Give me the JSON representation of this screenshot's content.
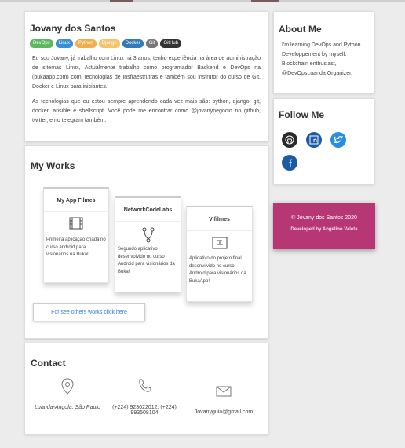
{
  "intro": {
    "name": "Jovany dos Santos",
    "tags": [
      {
        "label": "DevOps",
        "color": "#5cb85c"
      },
      {
        "label": "Linux",
        "color": "#3a8fd6"
      },
      {
        "label": "Python",
        "color": "#f0ad4e"
      },
      {
        "label": "Django",
        "color": "#f5c36b"
      },
      {
        "label": "Docker",
        "color": "#337ab7"
      },
      {
        "label": "Git",
        "color": "#777777"
      },
      {
        "label": "GitHub",
        "color": "#333333"
      }
    ],
    "paragraph1": "Eu sou Jovany, já trabalho com Linux há 3 anos, tenho experiência na área de administração de sitemas Linux, Actualmente trabalho como programador Backend e DevOps na (bukaapp.com) com Tecnologias de Insfraestrutras e também sou instrutor do curso de Git, Docker e Linux para iniciantes.",
    "paragraph2": "As tecnologias que eu estou sempre aprendendo cada vez mais são: python, django, git, docker, ansible e shellscript. Você pode me encontrar como @jovanynegocio no github, twitter, e no telegram também."
  },
  "works": {
    "heading": "My Works",
    "items": [
      {
        "title": "My App Filmes",
        "icon": "film-icon",
        "description": "Primeira aplicação criada no curso android para visionários na Buka!"
      },
      {
        "title": "NetworkCodeLabs",
        "icon": "git-branch-icon",
        "description": "Segundo aplicativo desenvolvido no curso Android para visionários da Buka!"
      },
      {
        "title": "Vifilmes",
        "icon": "document-icon",
        "description": "Aplicativo do projeto final desenvilvido no curso Android para visionários da BukaApp!"
      }
    ],
    "more_label": "For see others works click here"
  },
  "contact": {
    "heading": "Contact",
    "location": "Luanda-Angola, São Paulo",
    "phone": "(+224) 923622012, (+224) 993508104",
    "email": "Jovanyguia@gmail.com"
  },
  "about": {
    "heading": "About Me",
    "text": "I'm learning DevOps and Python Developpement by myself. Blockchain enthusiast, @DevOpsLuanda Organizer."
  },
  "follow": {
    "heading": "Follow Me",
    "networks": [
      "github-icon",
      "linkedin-icon",
      "twitter-icon",
      "facebook-icon"
    ]
  },
  "footer": {
    "copyright": "© Jovany dos Santos 2020",
    "developed_by": "Developed by Angelino Valeta",
    "color": "#b73674"
  }
}
